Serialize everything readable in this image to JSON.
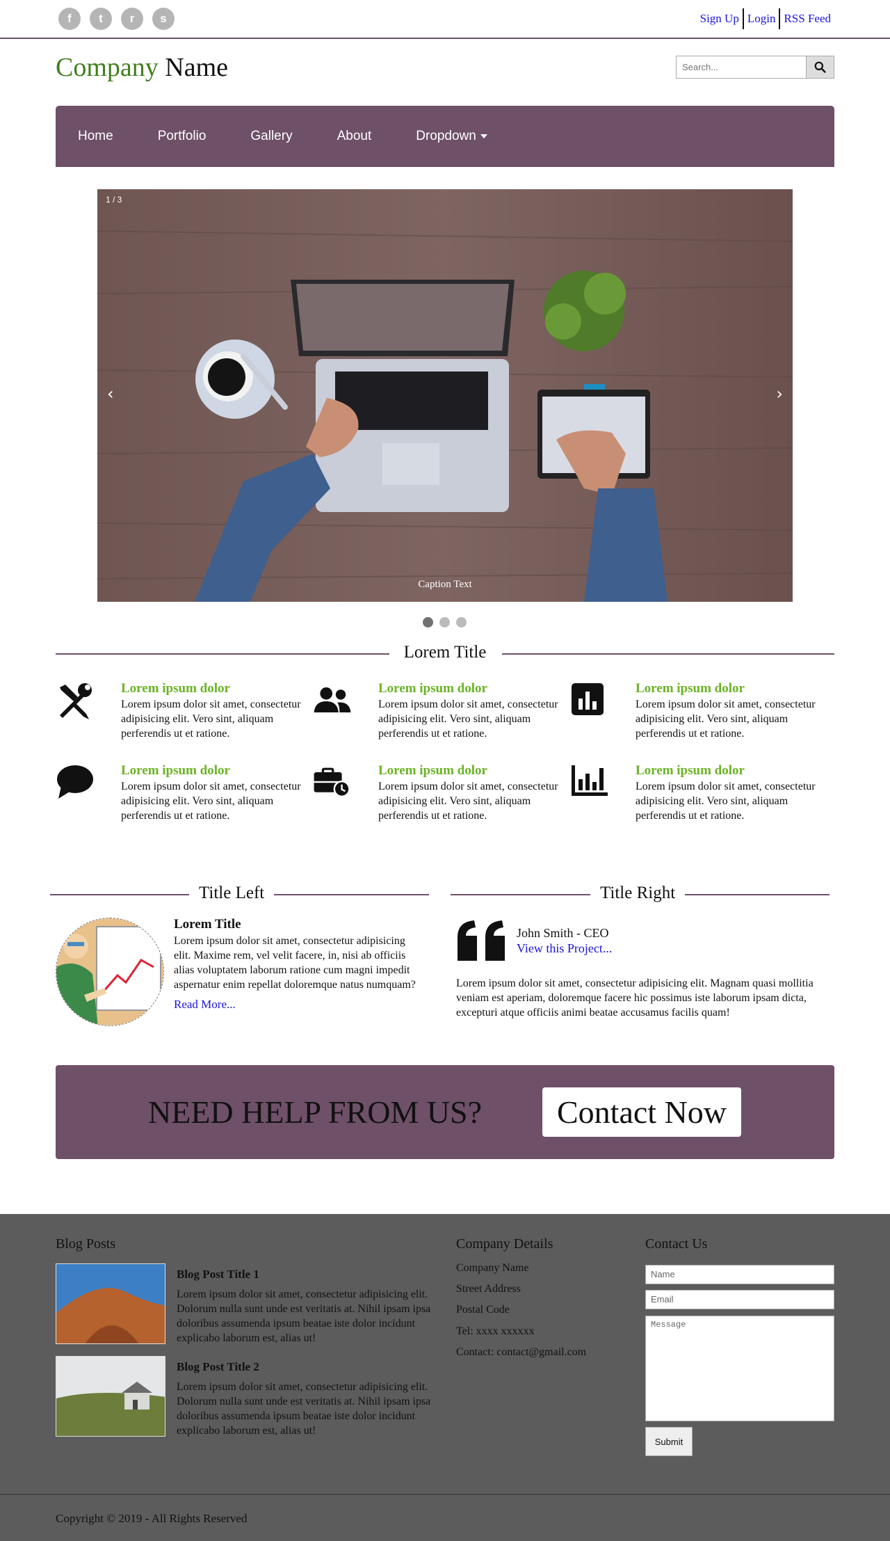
{
  "topbar": {
    "social": [
      {
        "icon": "facebook-icon",
        "glyph": "f"
      },
      {
        "icon": "twitter-icon",
        "glyph": "t"
      },
      {
        "icon": "reddit-icon",
        "glyph": "r"
      },
      {
        "icon": "stumbleupon-icon",
        "glyph": "s"
      }
    ],
    "links": [
      "Sign Up",
      "Login",
      "RSS Feed"
    ]
  },
  "header": {
    "logo_part1": "Company",
    "logo_part2": "Name",
    "search_placeholder": "Search..."
  },
  "nav": {
    "items": [
      "Home",
      "Portfolio",
      "Gallery",
      "About",
      "Dropdown"
    ]
  },
  "slideshow": {
    "counter": "1 / 3",
    "caption": "Caption Text",
    "prev": "‹",
    "next": "›",
    "active_index": 0,
    "total": 3
  },
  "features": {
    "title": "Lorem Title",
    "items": [
      {
        "icon": "tools-icon",
        "title": "Lorem ipsum dolor",
        "text": "Lorem ipsum dolor sit amet, consectetur adipisicing elit. Vero sint, aliquam perferendis ut et ratione."
      },
      {
        "icon": "users-icon",
        "title": "Lorem ipsum dolor",
        "text": "Lorem ipsum dolor sit amet, consectetur adipisicing elit. Vero sint, aliquam perferendis ut et ratione."
      },
      {
        "icon": "chart-square-icon",
        "title": "Lorem ipsum dolor",
        "text": "Lorem ipsum dolor sit amet, consectetur adipisicing elit. Vero sint, aliquam perferendis ut et ratione."
      },
      {
        "icon": "comment-icon",
        "title": "Lorem ipsum dolor",
        "text": "Lorem ipsum dolor sit amet, consectetur adipisicing elit. Vero sint, aliquam perferendis ut et ratione."
      },
      {
        "icon": "business-time-icon",
        "title": "Lorem ipsum dolor",
        "text": "Lorem ipsum dolor sit amet, consectetur adipisicing elit. Vero sint, aliquam perferendis ut et ratione."
      },
      {
        "icon": "bar-chart-icon",
        "title": "Lorem ipsum dolor",
        "text": "Lorem ipsum dolor sit amet, consectetur adipisicing elit. Vero sint, aliquam perferendis ut et ratione."
      }
    ]
  },
  "left": {
    "section_title": "Title Left",
    "heading": "Lorem Title",
    "text": "Lorem ipsum dolor sit amet, consectetur adipisicing elit. Maxime rem, vel velit facere, in, nisi ab officiis alias voluptatem laborum ratione cum magni impedit aspernatur enim repellat doloremque natus numquam?",
    "link": "Read More..."
  },
  "right": {
    "section_title": "Title Right",
    "name": "John Smith - CEO",
    "link": "View this Project...",
    "text": "Lorem ipsum dolor sit amet, consectetur adipisicing elit. Magnam quasi mollitia veniam est aperiam, doloremque facere hic possimus iste laborum ipsam dicta, excepturi atque officiis animi beatae accusamus facilis quam!"
  },
  "cta": {
    "question": "NEED HELP FROM US?",
    "button": "Contact Now"
  },
  "footer": {
    "blog_title": "Blog Posts",
    "posts": [
      {
        "title": "Blog Post Title 1",
        "text": "Lorem ipsum dolor sit amet, consectetur adipisicing elit. Dolorum nulla sunt unde est veritatis at. Nihil ipsam ipsa doloribus assumenda ipsum beatae iste dolor incidunt explicabo laborum est, alias ut!"
      },
      {
        "title": "Blog Post Title 2",
        "text": "Lorem ipsum dolor sit amet, consectetur adipisicing elit. Dolorum nulla sunt unde est veritatis at. Nihil ipsam ipsa doloribus assumenda ipsum beatae iste dolor incidunt explicabo laborum est, alias ut!"
      }
    ],
    "company_title": "Company Details",
    "company": [
      "Company Name",
      "Street Address",
      "Postal Code",
      "Tel: xxxx xxxxxx",
      "Contact: contact@gmail.com"
    ],
    "contact_title": "Contact Us",
    "form": {
      "name_placeholder": "Name",
      "email_placeholder": "Email",
      "message_placeholder": "Message",
      "submit": "Submit"
    },
    "copyright": "Copyright © 2019 - All Rights Reserved"
  },
  "colors": {
    "accent": "#6e5068",
    "logo_green": "#3f7f1e",
    "feature_green": "#6bb325",
    "link": "#1a13d6",
    "footer_bg": "#5c5c5c"
  }
}
